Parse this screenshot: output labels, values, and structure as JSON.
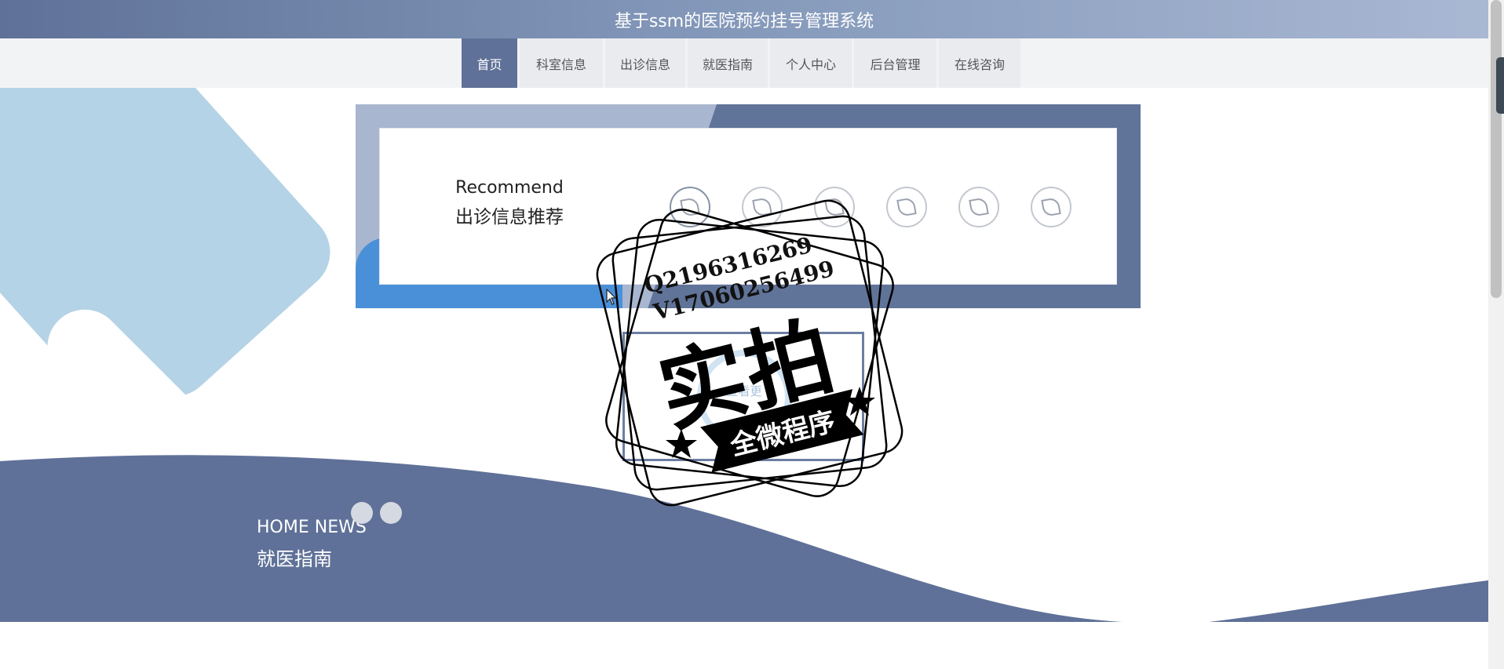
{
  "header": {
    "title": "基于ssm的医院预约挂号管理系统"
  },
  "nav": {
    "items": [
      {
        "label": "首页",
        "active": true
      },
      {
        "label": "科室信息",
        "active": false
      },
      {
        "label": "出诊信息",
        "active": false
      },
      {
        "label": "就医指南",
        "active": false
      },
      {
        "label": "个人中心",
        "active": false
      },
      {
        "label": "后台管理",
        "active": false
      },
      {
        "label": "在线咨询",
        "active": false
      }
    ]
  },
  "recommend": {
    "title_en": "Recommend",
    "title_cn": "出诊信息推荐",
    "item_icon": "leaf-icon",
    "more_label": "查看更"
  },
  "news": {
    "title_en": "HOME NEWS",
    "title_cn": "就医指南"
  },
  "watermark": {
    "line1": "Q2196316269",
    "line2": "V17060256499",
    "big": "实拍",
    "ribbon": "全微程序"
  },
  "colors": {
    "primary": "#5f7198",
    "nav_bg": "#e9ebef",
    "accent_light": "#b5d3e6"
  }
}
